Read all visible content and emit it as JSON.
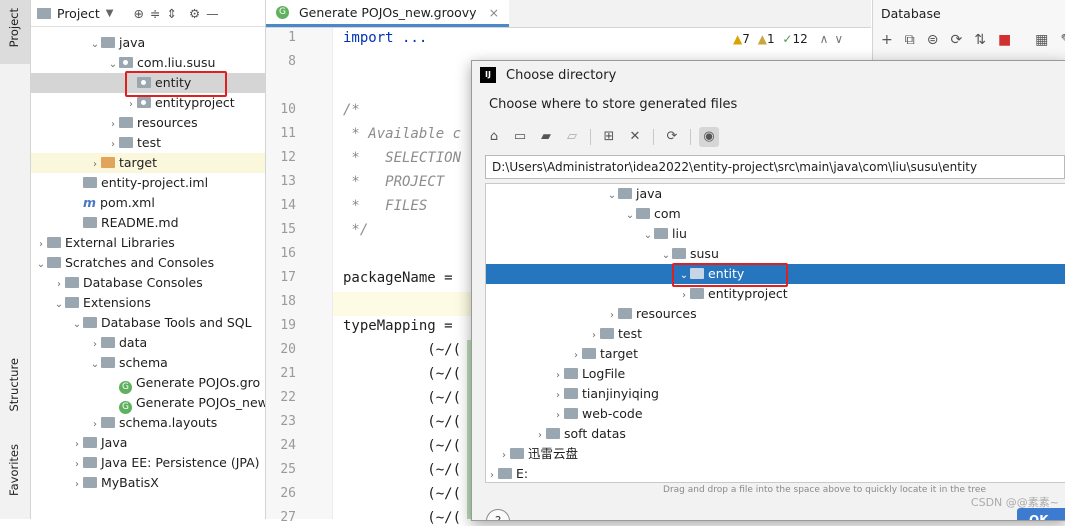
{
  "side_strip": {
    "project_tab": "Project",
    "structure_tab": "Structure",
    "favorites_tab": "Favorites"
  },
  "project_panel": {
    "title": "Project",
    "tree": [
      {
        "label": "java",
        "arrow": "v",
        "icon": "folder"
      },
      {
        "label": "com.liu.susu",
        "arrow": "v",
        "icon": "package"
      },
      {
        "label": "entity",
        "arrow": "",
        "icon": "package"
      },
      {
        "label": "entityproject",
        "arrow": ">",
        "icon": "package"
      },
      {
        "label": "resources",
        "arrow": ">",
        "icon": "folder"
      },
      {
        "label": "test",
        "arrow": ">",
        "icon": "folder"
      },
      {
        "label": "target",
        "arrow": ">",
        "icon": "folder-orange"
      },
      {
        "label": "entity-project.iml",
        "arrow": "",
        "icon": "file"
      },
      {
        "label": "pom.xml",
        "arrow": "",
        "icon": "maven"
      },
      {
        "label": "README.md",
        "arrow": "",
        "icon": "md"
      },
      {
        "label": "External Libraries",
        "arrow": ">",
        "icon": "library"
      },
      {
        "label": "Scratches and Consoles",
        "arrow": "v",
        "icon": "scratch"
      },
      {
        "label": "Database Consoles",
        "arrow": ">",
        "icon": "folder"
      },
      {
        "label": "Extensions",
        "arrow": "v",
        "icon": "folder"
      },
      {
        "label": "Database Tools and SQL",
        "arrow": "v",
        "icon": "folder"
      },
      {
        "label": "data",
        "arrow": ">",
        "icon": "folder"
      },
      {
        "label": "schema",
        "arrow": "v",
        "icon": "folder"
      },
      {
        "label": "Generate POJOs.gro",
        "arrow": "",
        "icon": "groovy"
      },
      {
        "label": "Generate POJOs_new",
        "arrow": "",
        "icon": "groovy"
      },
      {
        "label": "schema.layouts",
        "arrow": ">",
        "icon": "folder"
      },
      {
        "label": "Java",
        "arrow": ">",
        "icon": "folder"
      },
      {
        "label": "Java EE: Persistence (JPA)",
        "arrow": ">",
        "icon": "folder"
      },
      {
        "label": "MyBatisX",
        "arrow": ">",
        "icon": "folder"
      }
    ]
  },
  "editor": {
    "tab_label": "Generate POJOs_new.groovy",
    "inspections": {
      "warnings": "7",
      "weak": "1",
      "typos": "12"
    },
    "lines": [
      {
        "n": "1",
        "text": "import ...",
        "kind": "kw"
      },
      {
        "n": "8",
        "text": "",
        "kind": "plain"
      },
      {
        "n": "10",
        "text": "/*",
        "kind": "cm"
      },
      {
        "n": "11",
        "text": " * Available c",
        "kind": "cm"
      },
      {
        "n": "12",
        "text": " *   SELECTION",
        "kind": "cm"
      },
      {
        "n": "13",
        "text": " *   PROJECT",
        "kind": "cm"
      },
      {
        "n": "14",
        "text": " *   FILES",
        "kind": "cm"
      },
      {
        "n": "15",
        "text": " */",
        "kind": "cm"
      },
      {
        "n": "16",
        "text": "",
        "kind": "plain"
      },
      {
        "n": "17",
        "text": "packageName =",
        "kind": "plain"
      },
      {
        "n": "18",
        "text": "",
        "kind": "plain"
      },
      {
        "n": "19",
        "text": "typeMapping =",
        "kind": "plain"
      },
      {
        "n": "20",
        "text": "          (~/(",
        "kind": "plain"
      },
      {
        "n": "21",
        "text": "          (~/(",
        "kind": "plain"
      },
      {
        "n": "22",
        "text": "          (~/(",
        "kind": "plain"
      },
      {
        "n": "23",
        "text": "          (~/(",
        "kind": "plain"
      },
      {
        "n": "24",
        "text": "          (~/(",
        "kind": "plain"
      },
      {
        "n": "25",
        "text": "          (~/(",
        "kind": "plain"
      },
      {
        "n": "26",
        "text": "          (~/(",
        "kind": "plain"
      },
      {
        "n": "27",
        "text": "          (~/(",
        "kind": "plain"
      }
    ]
  },
  "database_panel": {
    "title": "Database"
  },
  "dialog": {
    "title": "Choose directory",
    "subtitle": "Choose where to store generated files",
    "path": "D:\\Users\\Administrator\\idea2022\\entity-project\\src\\main\\java\\com\\liu\\susu\\entity",
    "tree": [
      {
        "label": "java",
        "arrow": "v"
      },
      {
        "label": "com",
        "arrow": "v"
      },
      {
        "label": "liu",
        "arrow": "v"
      },
      {
        "label": "susu",
        "arrow": "v"
      },
      {
        "label": "entity",
        "arrow": "v"
      },
      {
        "label": "entityproject",
        "arrow": ">"
      },
      {
        "label": "resources",
        "arrow": ">"
      },
      {
        "label": "test",
        "arrow": ">"
      },
      {
        "label": "target",
        "arrow": ">"
      },
      {
        "label": "LogFile",
        "arrow": ">"
      },
      {
        "label": "tianjinyiqing",
        "arrow": ">"
      },
      {
        "label": "web-code",
        "arrow": ">"
      },
      {
        "label": "soft datas",
        "arrow": ">"
      },
      {
        "label": "迅雷云盘",
        "arrow": ">"
      },
      {
        "label": "E:",
        "arrow": ">"
      }
    ],
    "hint": "Drag and drop a file into the space above to quickly locate it in the tree",
    "help_label": "?",
    "ok_label": "OK"
  },
  "watermark": "CSDN @@素素~",
  "colors": {
    "selection": "#2675bf",
    "highlight_box": "#e02020",
    "ok_button": "#3d7bd1"
  }
}
